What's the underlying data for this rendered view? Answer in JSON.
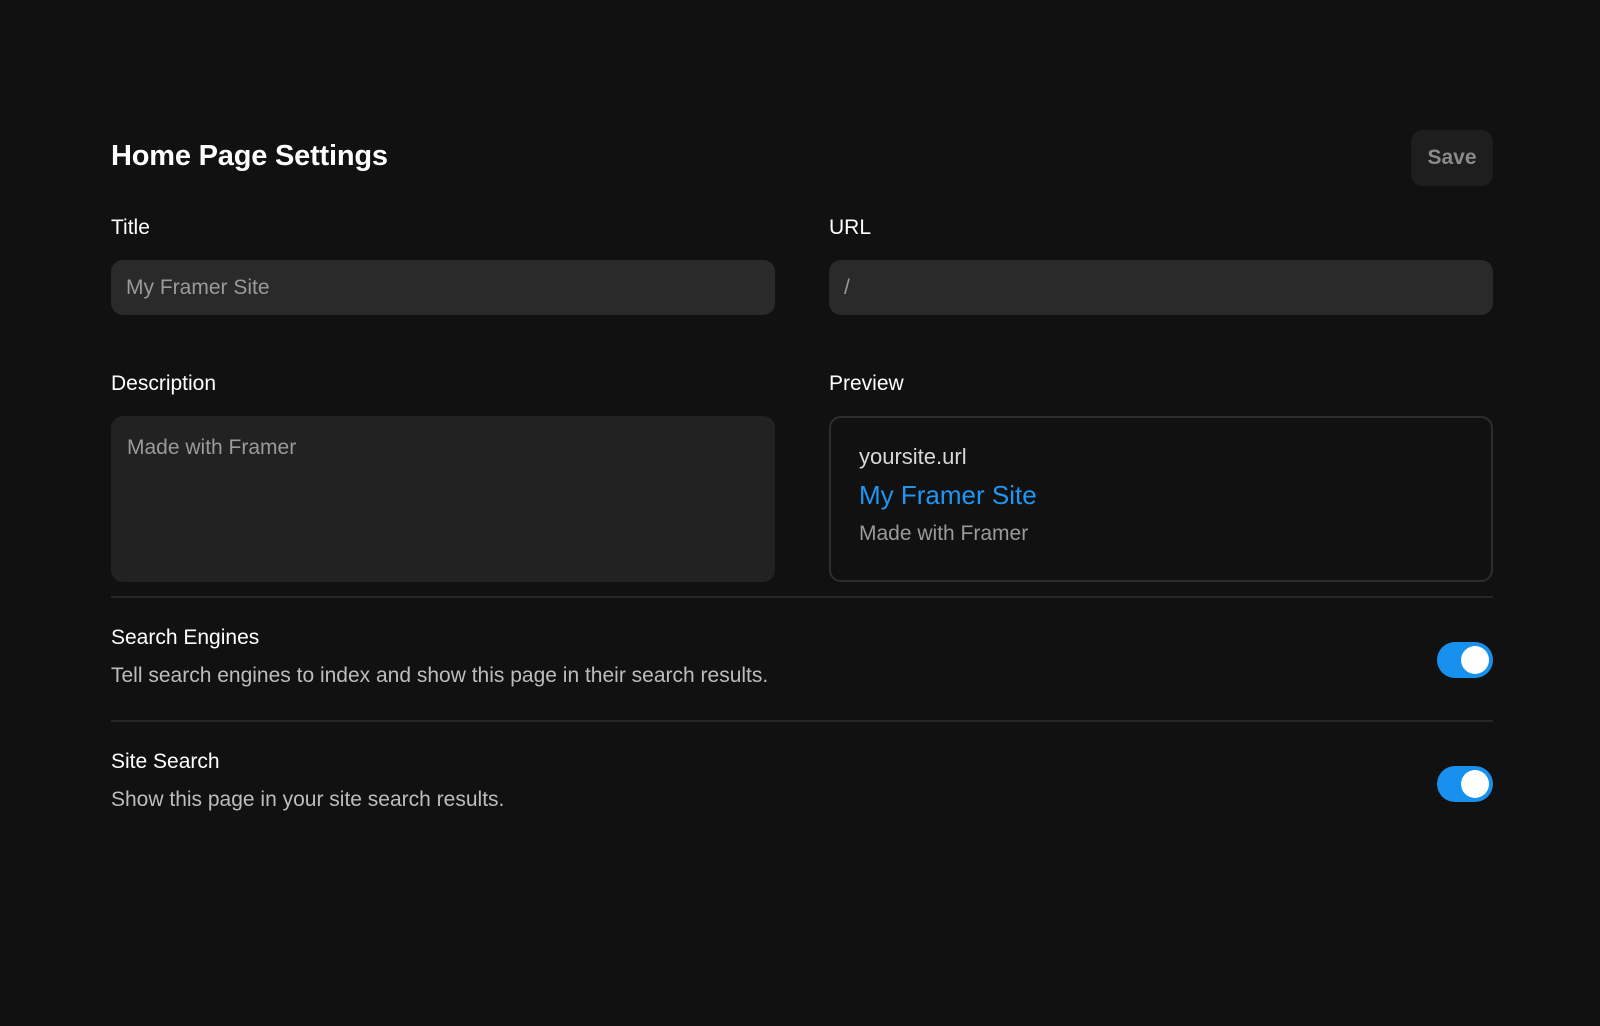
{
  "header": {
    "title": "Home Page Settings",
    "save_label": "Save"
  },
  "fields": {
    "title": {
      "label": "Title",
      "placeholder": "My Framer Site"
    },
    "url": {
      "label": "URL",
      "placeholder": "/"
    },
    "description": {
      "label": "Description",
      "placeholder": "Made with Framer"
    }
  },
  "preview": {
    "label": "Preview",
    "url": "yoursite.url",
    "title": "My Framer Site",
    "description": "Made with Framer"
  },
  "toggles": [
    {
      "title": "Search Engines",
      "description": "Tell search engines to index and show this page in their search results.",
      "enabled": true
    },
    {
      "title": "Site Search",
      "description": "Show this page in your site search results.",
      "enabled": true
    }
  ],
  "colors": {
    "background": "#111111",
    "accent": "#1790ee",
    "link": "#1f96f3"
  }
}
